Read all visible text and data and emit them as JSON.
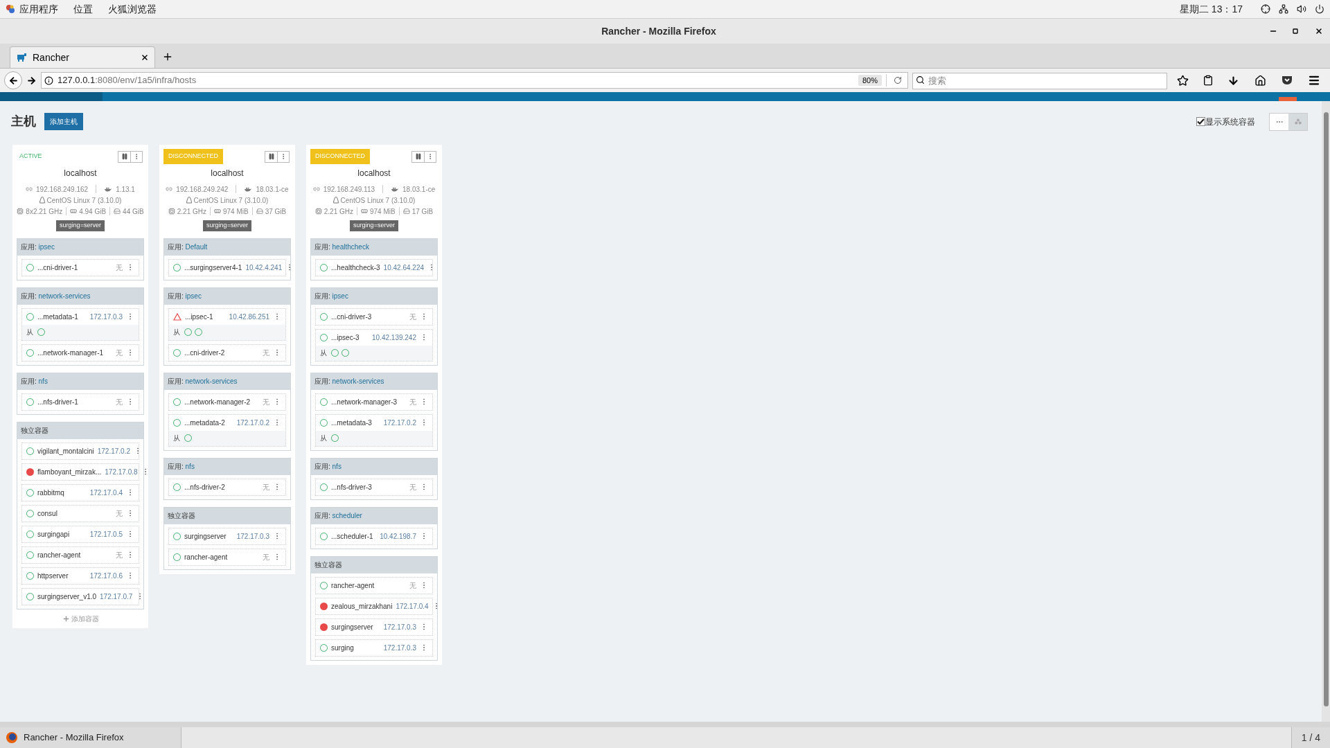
{
  "desktop_bar": {
    "menus": [
      "应用程序",
      "位置",
      "火狐浏览器"
    ],
    "clock": "星期二 13：17"
  },
  "window": {
    "title": "Rancher - Mozilla Firefox"
  },
  "tabs": [
    {
      "label": "Rancher",
      "selected": true
    }
  ],
  "nav": {
    "url_host": "127.0.0.1",
    "url_path": ":8080/env/1a5/infra/hosts",
    "zoom": "80%",
    "search_placeholder": "搜索"
  },
  "page": {
    "title": "主机",
    "add_button": "添加主机",
    "show_system": {
      "label": "显示系统容器",
      "checked": true
    },
    "views": [
      {
        "kind": "list",
        "selected": false
      },
      {
        "kind": "graph",
        "selected": true
      }
    ]
  },
  "hosts": [
    {
      "state": {
        "text": "ACTIVE",
        "kind": "active"
      },
      "name": "localhost",
      "ip": "192.168.249.162",
      "docker": "1.13.1",
      "os": "CentOS Linux 7 (3.10.0)",
      "cpu": "8x2.21 GHz",
      "memory": "4.94 GiB",
      "disk": "44 GiB",
      "label": "surging=server",
      "groups": [
        {
          "kind": "stack",
          "prefix": "应用:",
          "name": "ipsec",
          "containers": [
            {
              "name": "...cni-driver-1",
              "kind": "ok",
              "addr": {
                "text": "无",
                "kind": "none"
              }
            }
          ]
        },
        {
          "kind": "stack",
          "prefix": "应用:",
          "name": "network-services",
          "containers": [
            {
              "name": "...metadata-1",
              "kind": "ok",
              "addr": {
                "text": "172.17.0.3",
                "kind": "ip"
              },
              "sidekick_label": "从",
              "sidekicks": [
                {
                  "kind": "ok"
                }
              ]
            },
            {
              "name": "...network-manager-1",
              "kind": "ok",
              "addr": {
                "text": "无",
                "kind": "none"
              }
            }
          ]
        },
        {
          "kind": "stack",
          "prefix": "应用:",
          "name": "nfs",
          "containers": [
            {
              "name": "...nfs-driver-1",
              "kind": "ok",
              "addr": {
                "text": "无",
                "kind": "none"
              }
            }
          ]
        },
        {
          "kind": "standalone",
          "name": "独立容器",
          "containers": [
            {
              "name": "vigilant_montalcini",
              "kind": "ok",
              "addr": {
                "text": "172.17.0.2",
                "kind": "ip"
              }
            },
            {
              "name": "flamboyant_mirzak...",
              "kind": "error",
              "addr": {
                "text": "172.17.0.8",
                "kind": "ip"
              }
            },
            {
              "name": "rabbitmq",
              "kind": "ok",
              "addr": {
                "text": "172.17.0.4",
                "kind": "ip"
              }
            },
            {
              "name": "consul",
              "kind": "ok",
              "addr": {
                "text": "无",
                "kind": "none"
              }
            },
            {
              "name": "surgingapi",
              "kind": "ok",
              "addr": {
                "text": "172.17.0.5",
                "kind": "ip"
              }
            },
            {
              "name": "rancher-agent",
              "kind": "ok",
              "addr": {
                "text": "无",
                "kind": "none"
              }
            },
            {
              "name": "httpserver",
              "kind": "ok",
              "addr": {
                "text": "172.17.0.6",
                "kind": "ip"
              }
            },
            {
              "name": "surgingserver_v1.0",
              "kind": "ok",
              "addr": {
                "text": "172.17.0.7",
                "kind": "ip"
              }
            }
          ]
        }
      ],
      "add_container": "添加容器"
    },
    {
      "state": {
        "text": "DISCONNECTED",
        "kind": "disconnected"
      },
      "name": "localhost",
      "ip": "192.168.249.242",
      "docker": "18.03.1-ce",
      "os": "CentOS Linux 7 (3.10.0)",
      "cpu": "2.21 GHz",
      "memory": "974 MiB",
      "disk": "37 GiB",
      "label": "surging=server",
      "groups": [
        {
          "kind": "stack",
          "prefix": "应用:",
          "name": "Default",
          "containers": [
            {
              "name": "...surgingserver4-1",
              "kind": "ok",
              "addr": {
                "text": "10.42.4.241",
                "kind": "ip"
              }
            }
          ]
        },
        {
          "kind": "stack",
          "prefix": "应用:",
          "name": "ipsec",
          "containers": [
            {
              "name": "...ipsec-1",
              "kind": "warning",
              "addr": {
                "text": "10.42.86.251",
                "kind": "ip"
              },
              "sidekick_label": "从",
              "sidekicks": [
                {
                  "kind": "ok"
                },
                {
                  "kind": "ok"
                }
              ]
            },
            {
              "name": "...cni-driver-2",
              "kind": "ok",
              "addr": {
                "text": "无",
                "kind": "none"
              }
            }
          ]
        },
        {
          "kind": "stack",
          "prefix": "应用:",
          "name": "network-services",
          "containers": [
            {
              "name": "...network-manager-2",
              "kind": "ok",
              "addr": {
                "text": "无",
                "kind": "none"
              }
            },
            {
              "name": "...metadata-2",
              "kind": "ok",
              "addr": {
                "text": "172.17.0.2",
                "kind": "ip"
              },
              "sidekick_label": "从",
              "sidekicks": [
                {
                  "kind": "ok"
                }
              ]
            }
          ]
        },
        {
          "kind": "stack",
          "prefix": "应用:",
          "name": "nfs",
          "containers": [
            {
              "name": "...nfs-driver-2",
              "kind": "ok",
              "addr": {
                "text": "无",
                "kind": "none"
              }
            }
          ]
        },
        {
          "kind": "standalone",
          "name": "独立容器",
          "containers": [
            {
              "name": "surgingserver",
              "kind": "ok",
              "addr": {
                "text": "172.17.0.3",
                "kind": "ip"
              }
            },
            {
              "name": "rancher-agent",
              "kind": "ok",
              "addr": {
                "text": "无",
                "kind": "none"
              }
            }
          ]
        }
      ]
    },
    {
      "state": {
        "text": "DISCONNECTED",
        "kind": "disconnected"
      },
      "name": "localhost",
      "ip": "192.168.249.113",
      "docker": "18.03.1-ce",
      "os": "CentOS Linux 7 (3.10.0)",
      "cpu": "2.21 GHz",
      "memory": "974 MiB",
      "disk": "17 GiB",
      "label": "surging=server",
      "groups": [
        {
          "kind": "stack",
          "prefix": "应用:",
          "name": "healthcheck",
          "containers": [
            {
              "name": "...healthcheck-3",
              "kind": "ok",
              "addr": {
                "text": "10.42.64.224",
                "kind": "ip"
              }
            }
          ]
        },
        {
          "kind": "stack",
          "prefix": "应用:",
          "name": "ipsec",
          "containers": [
            {
              "name": "...cni-driver-3",
              "kind": "ok",
              "addr": {
                "text": "无",
                "kind": "none"
              }
            },
            {
              "name": "...ipsec-3",
              "kind": "ok",
              "addr": {
                "text": "10.42.139.242",
                "kind": "ip"
              },
              "sidekick_label": "从",
              "sidekicks": [
                {
                  "kind": "ok"
                },
                {
                  "kind": "ok"
                }
              ]
            }
          ]
        },
        {
          "kind": "stack",
          "prefix": "应用:",
          "name": "network-services",
          "containers": [
            {
              "name": "...network-manager-3",
              "kind": "ok",
              "addr": {
                "text": "无",
                "kind": "none"
              }
            },
            {
              "name": "...metadata-3",
              "kind": "ok",
              "addr": {
                "text": "172.17.0.2",
                "kind": "ip"
              },
              "sidekick_label": "从",
              "sidekicks": [
                {
                  "kind": "ok"
                }
              ]
            }
          ]
        },
        {
          "kind": "stack",
          "prefix": "应用:",
          "name": "nfs",
          "containers": [
            {
              "name": "...nfs-driver-3",
              "kind": "ok",
              "addr": {
                "text": "无",
                "kind": "none"
              }
            }
          ]
        },
        {
          "kind": "stack",
          "prefix": "应用:",
          "name": "scheduler",
          "containers": [
            {
              "name": "...scheduler-1",
              "kind": "ok",
              "addr": {
                "text": "10.42.198.7",
                "kind": "ip"
              }
            }
          ]
        },
        {
          "kind": "standalone",
          "name": "独立容器",
          "containers": [
            {
              "name": "rancher-agent",
              "kind": "ok",
              "addr": {
                "text": "无",
                "kind": "none"
              }
            },
            {
              "name": "zealous_mirzakhani",
              "kind": "error",
              "addr": {
                "text": "172.17.0.4",
                "kind": "ip"
              }
            },
            {
              "name": "surgingserver",
              "kind": "error",
              "addr": {
                "text": "172.17.0.3",
                "kind": "ip"
              }
            },
            {
              "name": "surging",
              "kind": "ok",
              "addr": {
                "text": "172.17.0.3",
                "kind": "ip"
              }
            }
          ]
        }
      ]
    }
  ],
  "taskbar": {
    "window": "Rancher - Mozilla Firefox",
    "workspace": "1 / 4"
  }
}
